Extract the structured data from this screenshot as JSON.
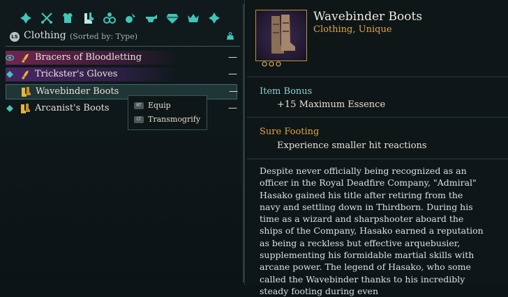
{
  "category_icons": [
    "all-items-icon",
    "weapons-icon",
    "armor-icon",
    "clothing-icon",
    "accessories-icon",
    "consumables-icon",
    "crafting-icon",
    "gems-icon",
    "valuables-icon",
    "misc-icon"
  ],
  "header": {
    "shoulder_button": "LS",
    "title": "Clothing",
    "sort": "(Sorted by: Type)"
  },
  "items": [
    {
      "name": "Bracers of Bloodletting",
      "dash": "—",
      "equipped": "eye"
    },
    {
      "name": "Trickster's Gloves",
      "dash": "—",
      "equipped": "diamond"
    },
    {
      "name": "Wavebinder Boots",
      "dash": "—",
      "equipped": "none"
    },
    {
      "name": "Arcanist's Boots",
      "dash": "—",
      "equipped": "diamond"
    }
  ],
  "context_menu": [
    {
      "button": "RT",
      "label": "Equip"
    },
    {
      "button": "LT",
      "label": "Transmogrify"
    }
  ],
  "detail": {
    "title": "Wavebinder Boots",
    "subtitle": "Clothing, Unique",
    "item_bonus_header": "Item Bonus",
    "item_bonus": "+15 Maximum Essence",
    "sure_footing_header": "Sure Footing",
    "sure_footing": "Experience smaller hit reactions",
    "lore": "Despite never officially being recognized as an officer in the Royal Deadfire Company, \"Admiral\" Hasako gained his title after retiring from the navy and settling down in Thirdborn. During his time as a wizard and sharpshooter aboard the ships of the Company, Hasako earned a reputation as being a reckless but effective arquebusier, supplementing his formidable martial skills with arcane power. The legend of Hasako, who some called the Wavebinder thanks to his incredibly steady footing during even"
  },
  "colors": {
    "accent_teal": "#3fc6b8",
    "unique_gold": "#e2a43e",
    "bg": "#0d1416"
  }
}
